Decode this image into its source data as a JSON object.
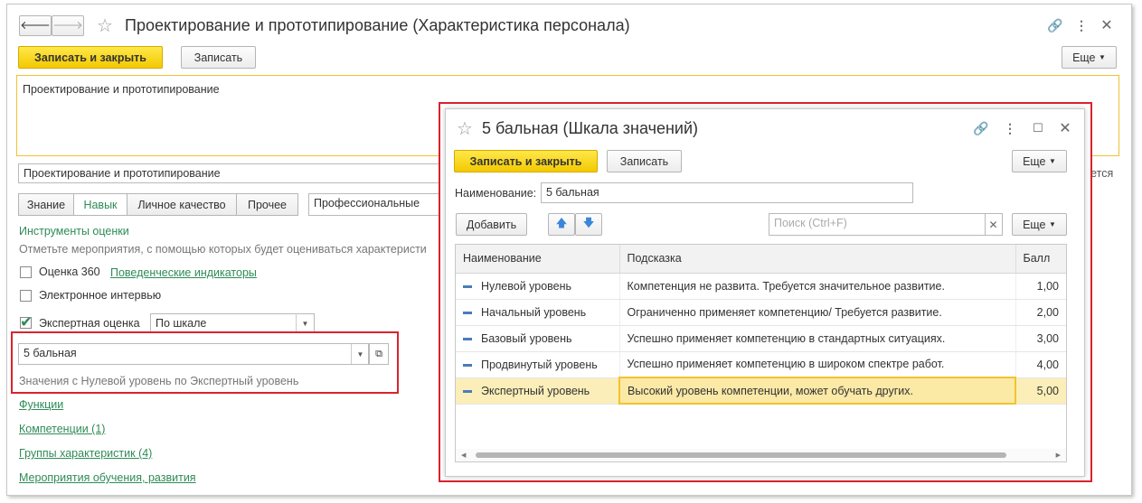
{
  "main": {
    "title": "Проектирование и прототипирование (Характеристика персонала)",
    "save_close": "Записать и закрыть",
    "save": "Записать",
    "more": "Еще",
    "description": "Проектирование и прототипирование",
    "name_field": "Проектирование и прототипирование",
    "right_cut": "уется",
    "tabs": [
      "Знание",
      "Навык",
      "Личное качество",
      "Прочее"
    ],
    "category": "Профессиональные",
    "tools_title": "Инструменты оценки",
    "tools_hint": "Отметьте мероприятия, с помощью которых будет оцениваться характеристи",
    "eval360": "Оценка 360",
    "behavior_link": "Поведенческие индикаторы",
    "interview": "Электронное интервью",
    "expert": "Экспертная оценка",
    "expert_mode": "По шкале",
    "scale": "5 бальная",
    "scale_hint": "Значения с Нулевой уровень по Экспертный уровень",
    "links": [
      "Функции",
      "Компетенции (1)",
      "Группы характеристик (4)",
      "Мероприятия обучения, развития"
    ]
  },
  "dialog": {
    "title": "5 бальная (Шкала значений)",
    "save_close": "Записать и закрыть",
    "save": "Записать",
    "more": "Еще",
    "name_label": "Наименование:",
    "name_value": "5 бальная",
    "add": "Добавить",
    "search_placeholder": "Поиск (Ctrl+F)",
    "more2": "Еще",
    "columns": [
      "Наименование",
      "Подсказка",
      "Балл"
    ],
    "rows": [
      {
        "name": "Нулевой уровень",
        "hint": "Компетенция не развита. Требуется значительное развитие.",
        "score": "1,00"
      },
      {
        "name": "Начальный уровень",
        "hint": "Ограниченно применяет компетенцию/ Требуется развитие.",
        "score": "2,00"
      },
      {
        "name": "Базовый уровень",
        "hint": "Успешно применяет компетенцию в стандартных ситуациях.",
        "score": "3,00"
      },
      {
        "name": "Продвинутый уровень",
        "hint": "Успешно применяет компетенцию в широком спектре работ.",
        "score": "4,00"
      },
      {
        "name": "Экспертный уровень",
        "hint": "Высокий уровень компетенции, может обучать других.",
        "score": "5,00"
      }
    ]
  },
  "colors": {
    "accent_yellow": "#f3c900",
    "link_green": "#2e8b57",
    "highlight_red": "#d9232e",
    "selected_row": "#fbeeb8"
  }
}
